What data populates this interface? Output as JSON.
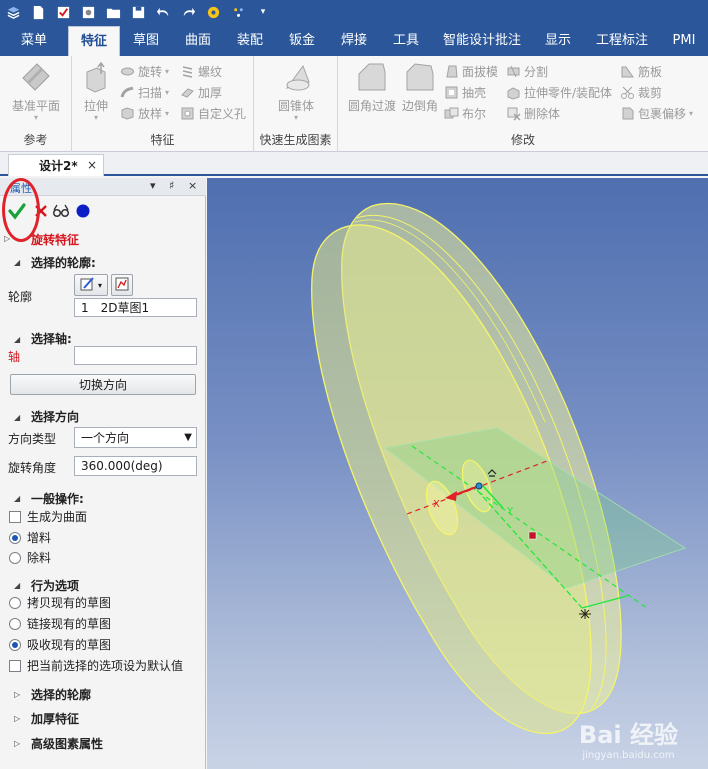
{
  "tabs": [
    "菜单",
    "特征",
    "草图",
    "曲面",
    "装配",
    "钣金",
    "焊接",
    "工具",
    "智能设计批注",
    "显示",
    "工程标注",
    "PMI"
  ],
  "active_tab": "特征",
  "ribbon": {
    "group_ref": {
      "label": "参考",
      "base_plane": "基准平面"
    },
    "group_feature": {
      "label": "特征",
      "extrude": "拉伸",
      "revolve": "旋转",
      "sweep": "扫描",
      "loft": "放样",
      "thread": "螺纹",
      "thicken": "加厚",
      "custom_hole": "自定义孔"
    },
    "group_fast": {
      "label": "快速生成图素",
      "cylinder": "圆锥体"
    },
    "group_modify": {
      "label": "修改",
      "fillet": "圆角过渡",
      "chamfer": "边倒角",
      "draft": "面拔模",
      "shell": "抽壳",
      "boolean": "布尔",
      "split": "分割",
      "extend_part": "拉伸零件/装配体",
      "delete_body": "删除体",
      "rib": "筋板",
      "trim": "裁剪",
      "wrap_offset": "包裹偏移"
    }
  },
  "document": {
    "tab_title": "设计2*",
    "close": "×"
  },
  "panel": {
    "title": "属性",
    "header_controls": [
      "▾",
      "♯",
      "×"
    ],
    "feature_title": "旋转特征",
    "sections": {
      "profile": {
        "title": "选择的轮廓:",
        "label": "轮廓",
        "item_index": "1",
        "item_name": "2D草图1"
      },
      "axis": {
        "title": "选择轴:",
        "label": "轴",
        "toggle_button": "切换方向"
      },
      "direction": {
        "title": "选择方向",
        "type_label": "方向类型",
        "type_value": "一个方向",
        "angle_label": "旋转角度",
        "angle_value": "360.000(deg)"
      },
      "general": {
        "title": "一般操作:",
        "as_surface": "生成为曲面",
        "add": "增料",
        "remove": "除料"
      },
      "behavior": {
        "title": "行为选项",
        "copy_sketch": "拷贝现有的草图",
        "link_sketch": "链接现有的草图",
        "absorb_sketch": "吸收现有的草图",
        "set_default": "把当前选择的选项设为默认值"
      },
      "collapsed": [
        "选择的轮廓",
        "加厚特征",
        "高级图素属性"
      ]
    }
  },
  "viewport": {
    "label_x": "X",
    "label_y": "Y",
    "watermark": "Bai 经验",
    "watermark_sub": "jingyan.baidu.com"
  },
  "colors": {
    "ribbon_blue": "#2b579a",
    "accent_red": "#d4161e",
    "ok_green": "#18a33a",
    "model_yellow": "#f3f38a"
  }
}
